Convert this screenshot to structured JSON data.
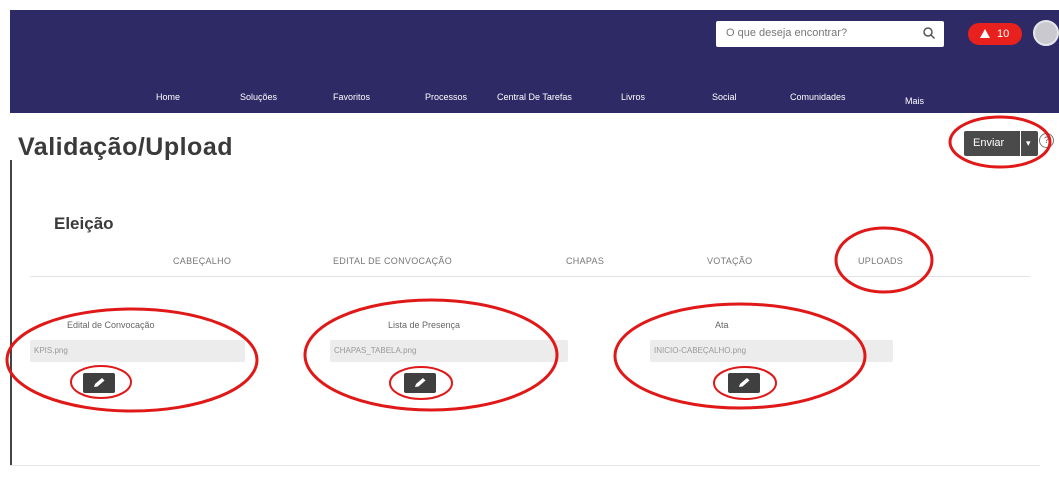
{
  "header": {
    "search": {
      "placeholder": "O que deseja encontrar?"
    },
    "alert_badge": {
      "count": "10"
    },
    "nav": [
      {
        "label": "Home"
      },
      {
        "label": "Soluções"
      },
      {
        "label": "Favoritos"
      },
      {
        "label": "Processos"
      },
      {
        "label": "Central De Tarefas"
      },
      {
        "label": "Livros"
      },
      {
        "label": "Social"
      },
      {
        "label": "Comunidades"
      },
      {
        "label": "Mais"
      }
    ]
  },
  "page": {
    "title": "Validação/Upload",
    "send_button": "Enviar",
    "send_caret": "▾",
    "help_icon": "?"
  },
  "form": {
    "section_title": "Eleição",
    "tabs": [
      {
        "label": "CABEÇALHO"
      },
      {
        "label": "EDITAL DE CONVOCAÇÃO"
      },
      {
        "label": "CHAPAS"
      },
      {
        "label": "VOTAÇÃO"
      },
      {
        "label": "UPLOADS"
      }
    ],
    "uploads": [
      {
        "label": "Edital de Convocação",
        "file": "KPIS.png"
      },
      {
        "label": "Lista de Presença",
        "file": "CHAPAS_TABELA.png"
      },
      {
        "label": "Ata",
        "file": "INICIO-CABEÇALHO.png"
      }
    ]
  },
  "colors": {
    "header_bg": "#2e2a66",
    "alert": "#e8201e",
    "annotation": "#e01818",
    "button_dark": "#3f3f3f"
  },
  "icons": [
    "search-icon",
    "alert-icon",
    "avatar",
    "chevron-down-icon",
    "help-icon",
    "pencil-icon"
  ]
}
